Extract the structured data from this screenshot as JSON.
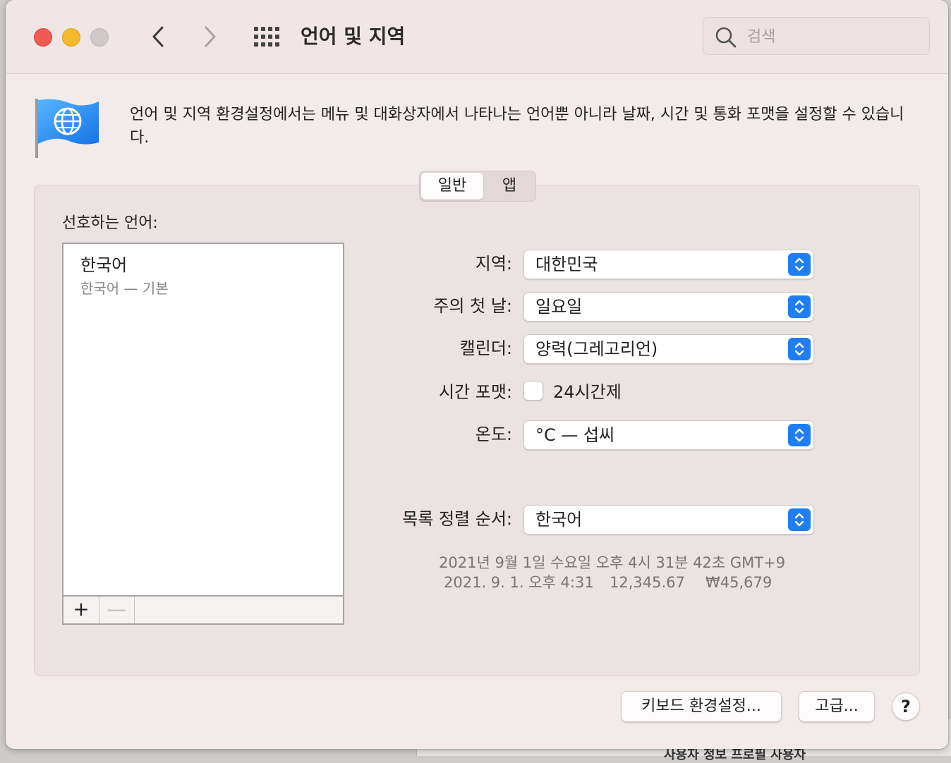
{
  "window": {
    "title": "언어 및 지역",
    "search_placeholder": "검색"
  },
  "description": "언어 및 지역 환경설정에서는 메뉴 및 대화상자에서 나타나는 언어뿐 아니라 날짜, 시간 및 통화 포맷을 설정할 수 있습니다.",
  "tabs": [
    {
      "label": "일반",
      "active": true
    },
    {
      "label": "앱",
      "active": false
    }
  ],
  "preferred_languages": {
    "label": "선호하는 언어:",
    "items": [
      {
        "name": "한국어",
        "sub": "한국어 — 기본"
      }
    ],
    "add_label": "+",
    "remove_label": "—"
  },
  "settings": {
    "region": {
      "label": "지역:",
      "value": "대한민국"
    },
    "first_day": {
      "label": "주의 첫 날:",
      "value": "일요일"
    },
    "calendar": {
      "label": "캘린더:",
      "value": "양력(그레고리언)"
    },
    "time_format": {
      "label": "시간 포맷:",
      "checkbox_label": "24시간제",
      "checked": false
    },
    "temperature": {
      "label": "온도:",
      "value": "°C — 섭씨"
    },
    "sort_order": {
      "label": "목록 정렬 순서:",
      "value": "한국어"
    }
  },
  "sample": {
    "line1": "2021년 9월 1일 수요일 오후 4시 31분 42초 GMT+9",
    "date_short": "2021. 9. 1. 오후 4:31",
    "number": "12,345.67",
    "currency": "₩45,679"
  },
  "buttons": {
    "keyboard": "키보드 환경설정...",
    "advanced": "고급...",
    "help": "?"
  },
  "background_window": {
    "text": "사용자 정보   프로필 사용자"
  },
  "colors": {
    "accent": "#1f7ef4",
    "close": "#ee5b53",
    "minimize": "#f6b92c",
    "window_bg": "#f3eaea"
  }
}
